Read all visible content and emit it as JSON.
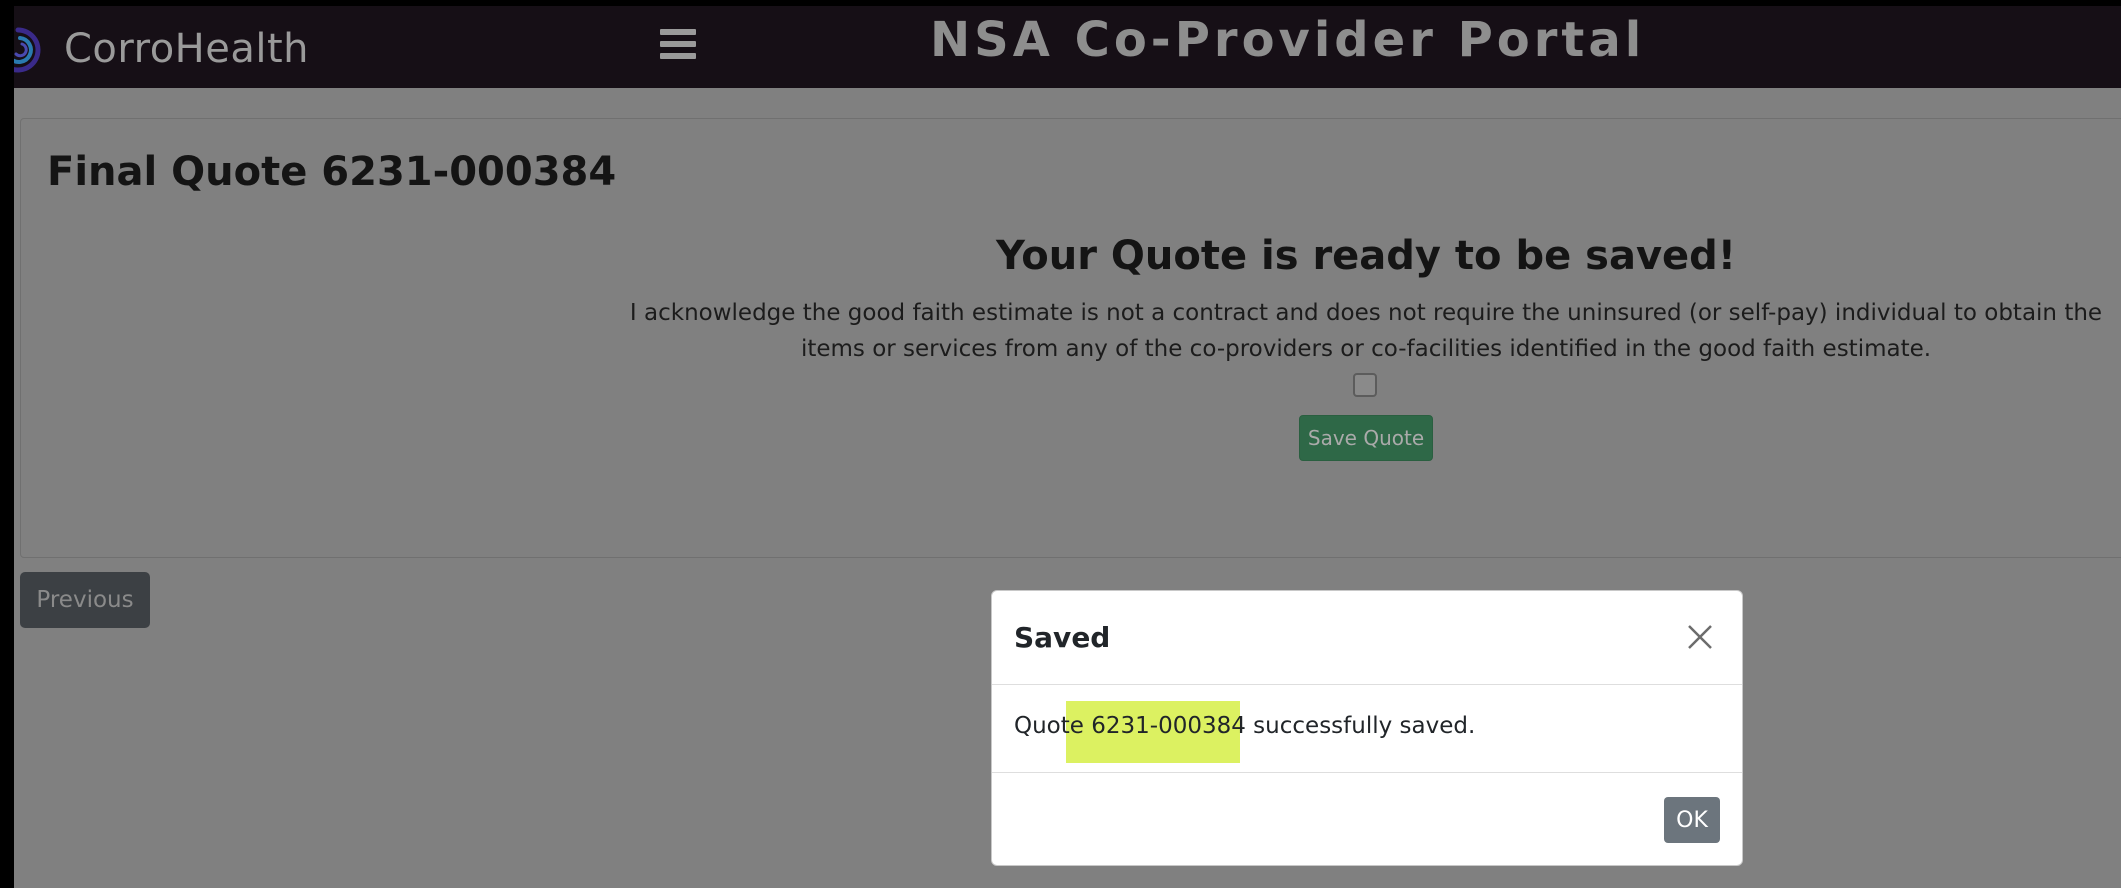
{
  "header": {
    "brand_name": "CorroHealth",
    "portal_title": "NSA Co-Provider Portal"
  },
  "card": {
    "title": "Final Quote 6231-000384",
    "ready_heading": "Your Quote is ready to be saved!",
    "acknowledgement": "I acknowledge the good faith estimate is not a contract and does not require the uninsured (or self-pay) individual to obtain the items or services from any of the co-providers or co-facilities identified in the good faith estimate.",
    "save_quote_label": "Save Quote"
  },
  "navigation": {
    "previous_label": "Previous"
  },
  "modal": {
    "title": "Saved",
    "message_prefix": "Quote ",
    "quote_number": "6231-000384",
    "message_suffix": " successfully saved.",
    "ok_label": "OK"
  },
  "colors": {
    "header_bg": "#160f16",
    "page_bg": "#808080",
    "save_button": "#2e6847",
    "previous_button": "#3c4044",
    "ok_button": "#6c757d",
    "highlight": "#d8ef50"
  },
  "icons": {
    "brand": "corrohealth-swirl-logo-icon",
    "menu": "hamburger-menu-icon",
    "close": "close-x-icon"
  }
}
